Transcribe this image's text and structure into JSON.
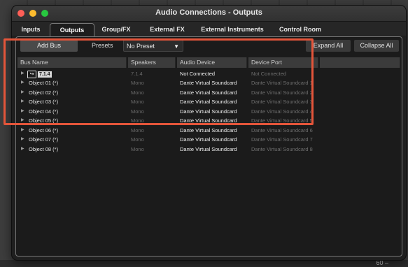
{
  "window": {
    "title": "Audio Connections - Outputs"
  },
  "tabs": [
    {
      "label": "Inputs",
      "active": false
    },
    {
      "label": "Outputs",
      "active": true
    },
    {
      "label": "Group/FX",
      "active": false
    },
    {
      "label": "External FX",
      "active": false
    },
    {
      "label": "External Instruments",
      "active": false
    },
    {
      "label": "Control Room",
      "active": false
    }
  ],
  "toolbar": {
    "add_bus_label": "Add Bus",
    "presets_label": "Presets",
    "preset_value": "No Preset",
    "expand_all_label": "Expand All",
    "collapse_all_label": "Collapse All"
  },
  "table": {
    "columns": [
      "Bus Name",
      "Speakers",
      "Audio Device",
      "Device Port"
    ],
    "main_bus": {
      "badge": "7.1.4",
      "speakers": "7.1.4",
      "device": "Not Connected",
      "port": "Not Connected"
    },
    "rows": [
      {
        "name": "Object  01 (*)",
        "speakers": "Mono",
        "device": "Dante Virtual Soundcard",
        "port": "Dante Virtual Soundcard 1"
      },
      {
        "name": "Object  02 (*)",
        "speakers": "Mono",
        "device": "Dante Virtual Soundcard",
        "port": "Dante Virtual Soundcard 2"
      },
      {
        "name": "Object  03 (*)",
        "speakers": "Mono",
        "device": "Dante Virtual Soundcard",
        "port": "Dante Virtual Soundcard 3"
      },
      {
        "name": "Object  04 (*)",
        "speakers": "Mono",
        "device": "Dante Virtual Soundcard",
        "port": "Dante Virtual Soundcard 4"
      },
      {
        "name": "Object  05 (*)",
        "speakers": "Mono",
        "device": "Dante Virtual Soundcard",
        "port": "Dante Virtual Soundcard 5"
      },
      {
        "name": "Object  06 (*)",
        "speakers": "Mono",
        "device": "Dante Virtual Soundcard",
        "port": "Dante Virtual Soundcard 6"
      },
      {
        "name": "Object  07 (*)",
        "speakers": "Mono",
        "device": "Dante Virtual Soundcard",
        "port": "Dante Virtual Soundcard 7"
      },
      {
        "name": "Object  08 (*)",
        "speakers": "Mono",
        "device": "Dante Virtual Soundcard",
        "port": "Dante Virtual Soundcard 8"
      }
    ]
  },
  "background": {
    "corner_label": "60 –"
  },
  "colors": {
    "highlight": "#e4553a",
    "window_bg": "#1f1f1f"
  }
}
